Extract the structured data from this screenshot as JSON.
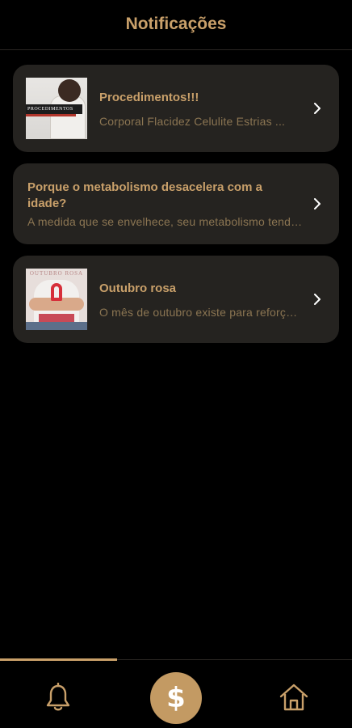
{
  "header": {
    "title": "Notificações"
  },
  "notifications": [
    {
      "title": "Procedimentos!!!",
      "subtitle": "Corporal Flacidez Celulite Estrias ...",
      "thumb": "procedimentos-image",
      "thumb_text": "PROCEDIMENTOS"
    },
    {
      "title": "Porque o metabolismo desacelera com a idade?",
      "subtitle": "A medida que se envelhece, seu metabolismo tende ..."
    },
    {
      "title": "Outubro rosa",
      "subtitle": "O mês de outubro existe para reforçar ...",
      "thumb": "outubro-rosa-image",
      "thumb_text": "OUTUBRO ROSA"
    }
  ],
  "tabbar": {
    "left": "bell-icon",
    "center": "$",
    "right": "home-icon",
    "active": "left"
  },
  "colors": {
    "accent": "#c9a06a",
    "card": "#252320",
    "muted": "#8b7552",
    "fab": "#c39a63"
  }
}
